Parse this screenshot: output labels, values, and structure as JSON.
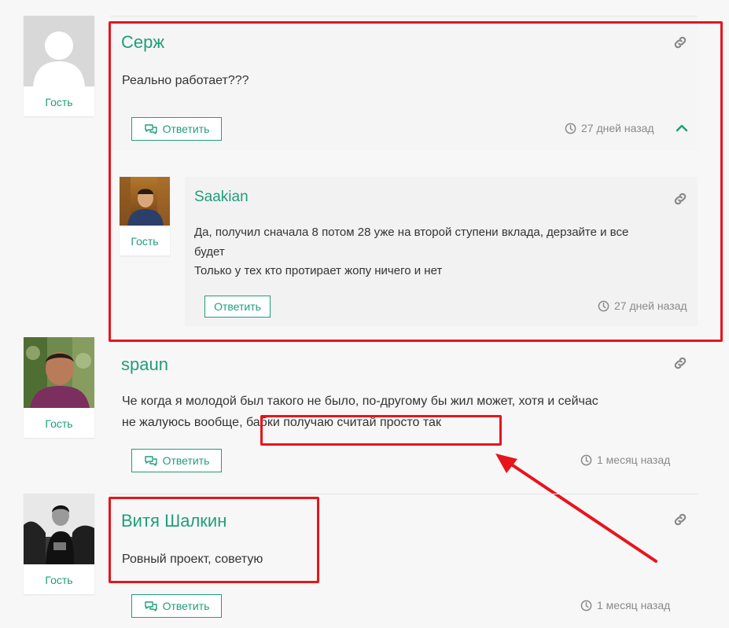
{
  "comments": [
    {
      "author": "Серж",
      "role": "Гость",
      "text": "Реально работает???",
      "reply_label": "Ответить",
      "time": "27 дней назад"
    },
    {
      "author": "Saakian",
      "role": "Гость",
      "text_line1": "Да, получил сначала 8 потом 28 уже на второй ступени вклада, дерзайте и все",
      "text_line2": "будет",
      "text_line3": "Только у тех кто протирает жопу ничего и нет",
      "reply_label": "Ответить",
      "time": "27 дней назад"
    },
    {
      "author": "spaun",
      "role": "Гость",
      "text_line1": "Че когда я молодой был такого не было, по-другому бы жил может, хотя и сейчас",
      "text_line2_a": "не жалуюсь вообще, ",
      "text_line2_b": "бабки получаю считай просто так",
      "reply_label": "Ответить",
      "time": "1 месяц назад"
    },
    {
      "author": "Витя Шалкин",
      "role": "Гость",
      "text": "Ровный проект, советую",
      "reply_label": "Ответить",
      "time": "1 месяц назад"
    }
  ],
  "icons": {
    "link": "link-icon",
    "reply": "comments-icon",
    "clock": "clock-icon",
    "collapse": "chevron-up-icon"
  },
  "colors": {
    "accent": "#1f9e7a",
    "annotation": "#e8141c"
  }
}
